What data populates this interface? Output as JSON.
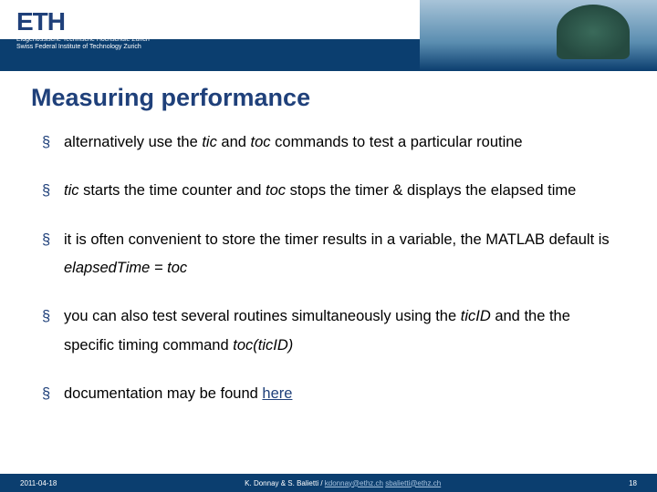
{
  "header": {
    "logo": "ETH",
    "logo_sub_line1": "Eidgenössische Technische Hochschule Zürich",
    "logo_sub_line2": "Swiss Federal Institute of Technology Zurich"
  },
  "title": "Measuring performance",
  "bullets": [
    {
      "pre": "alternatively use the ",
      "i1": "tic",
      "mid1": " and ",
      "i2": "toc",
      "post": " commands to test a particular routine"
    },
    {
      "i1": "tic",
      "mid1": " starts the time counter and ",
      "i2": "toc",
      "post": " stops the timer & displays the elapsed time"
    },
    {
      "pre": "it is often convenient to store the timer results in a variable, the MATLAB default is ",
      "i1": "elapsedTime = toc"
    },
    {
      "pre": "you can also test several routines simultaneously using the ",
      "i1": "ticID",
      "mid1": " and the the specific timing command ",
      "i2": "toc(ticID)"
    },
    {
      "pre": "documentation may be found ",
      "link": "here"
    }
  ],
  "footer": {
    "date": "2011-04-18",
    "authors": "K. Donnay & S. Balietti / ",
    "email1": "kdonnay@ethz.ch",
    "sep": "   ",
    "email2": "sbalietti@ethz.ch",
    "page": "18"
  }
}
